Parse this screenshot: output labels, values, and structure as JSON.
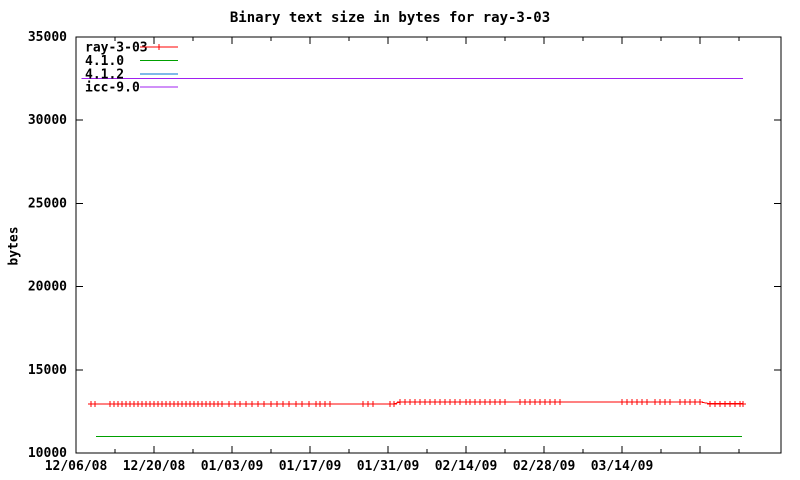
{
  "page": {
    "background_color": "#ffffff",
    "foreground_color": "#000000"
  },
  "chart_data": {
    "type": "line",
    "title": "Binary text size in bytes for ray-3-03",
    "xlabel": "",
    "ylabel": "bytes",
    "ylim": [
      10000,
      35000
    ],
    "ytick_labels": [
      "10000",
      "15000",
      "20000",
      "25000",
      "30000",
      "35000"
    ],
    "ytick_values": [
      10000,
      15000,
      20000,
      25000,
      30000,
      35000
    ],
    "xtick_labels": [
      "12/06/08",
      "12/20/08",
      "01/03/09",
      "01/17/09",
      "01/31/09",
      "02/14/09",
      "02/28/09",
      "03/14/09"
    ],
    "x_major_interval_days": 14,
    "x_minor_interval_days": 7,
    "x_days_total": 126,
    "grid": false,
    "legend_position": "top-left",
    "legend": [
      "ray-3-03",
      "4.1.0",
      "4.1.2",
      "icc-9.0"
    ],
    "series": [
      {
        "name": "ray-3-03",
        "color": "#ff0000",
        "marker": "plus",
        "points": [
          [
            2.7,
            12950
          ],
          [
            3.4,
            12950
          ],
          [
            6.1,
            12950
          ],
          [
            6.8,
            12950
          ],
          [
            7.5,
            12950
          ],
          [
            8.2,
            12950
          ],
          [
            8.9,
            12950
          ],
          [
            9.7,
            12950
          ],
          [
            10.4,
            12950
          ],
          [
            11.1,
            12950
          ],
          [
            11.8,
            12950
          ],
          [
            12.6,
            12950
          ],
          [
            13.3,
            12950
          ],
          [
            14.0,
            12950
          ],
          [
            14.7,
            12950
          ],
          [
            15.4,
            12950
          ],
          [
            16.2,
            12950
          ],
          [
            16.9,
            12950
          ],
          [
            17.6,
            12950
          ],
          [
            18.3,
            12950
          ],
          [
            19.0,
            12950
          ],
          [
            19.8,
            12950
          ],
          [
            20.5,
            12950
          ],
          [
            21.2,
            12950
          ],
          [
            21.9,
            12950
          ],
          [
            22.6,
            12950
          ],
          [
            23.4,
            12950
          ],
          [
            24.1,
            12950
          ],
          [
            24.8,
            12950
          ],
          [
            25.5,
            12950
          ],
          [
            26.2,
            12950
          ],
          [
            27.5,
            12950
          ],
          [
            28.5,
            12950
          ],
          [
            29.5,
            12950
          ],
          [
            30.6,
            12950
          ],
          [
            31.6,
            12950
          ],
          [
            32.7,
            12950
          ],
          [
            33.8,
            12950
          ],
          [
            35.0,
            12950
          ],
          [
            36.1,
            12950
          ],
          [
            37.2,
            12950
          ],
          [
            38.3,
            12950
          ],
          [
            39.4,
            12950
          ],
          [
            40.5,
            12950
          ],
          [
            41.9,
            12950
          ],
          [
            43.1,
            12950
          ],
          [
            43.8,
            12950
          ],
          [
            44.7,
            12950
          ],
          [
            45.6,
            12950
          ],
          [
            51.5,
            12950
          ],
          [
            52.4,
            12950
          ],
          [
            53.3,
            12950
          ],
          [
            56.4,
            12950
          ],
          [
            57.1,
            12950
          ],
          [
            58.2,
            13070
          ],
          [
            59.1,
            13070
          ],
          [
            60.0,
            13070
          ],
          [
            60.9,
            13070
          ],
          [
            61.8,
            13070
          ],
          [
            62.7,
            13070
          ],
          [
            63.6,
            13070
          ],
          [
            64.5,
            13070
          ],
          [
            65.4,
            13070
          ],
          [
            66.3,
            13070
          ],
          [
            67.2,
            13070
          ],
          [
            68.1,
            13070
          ],
          [
            69.0,
            13070
          ],
          [
            70.0,
            13070
          ],
          [
            70.7,
            13070
          ],
          [
            71.6,
            13070
          ],
          [
            72.5,
            13070
          ],
          [
            73.4,
            13070
          ],
          [
            74.3,
            13070
          ],
          [
            75.2,
            13070
          ],
          [
            76.1,
            13070
          ],
          [
            77.0,
            13070
          ],
          [
            79.7,
            13070
          ],
          [
            80.6,
            13070
          ],
          [
            81.5,
            13070
          ],
          [
            82.4,
            13070
          ],
          [
            83.3,
            13070
          ],
          [
            84.2,
            13070
          ],
          [
            85.1,
            13070
          ],
          [
            86.0,
            13070
          ],
          [
            86.9,
            13070
          ],
          [
            98.0,
            13070
          ],
          [
            98.9,
            13070
          ],
          [
            99.8,
            13070
          ],
          [
            100.7,
            13070
          ],
          [
            101.6,
            13070
          ],
          [
            102.5,
            13070
          ],
          [
            103.9,
            13070
          ],
          [
            104.8,
            13070
          ],
          [
            105.7,
            13070
          ],
          [
            106.6,
            13070
          ],
          [
            108.4,
            13070
          ],
          [
            109.3,
            13070
          ],
          [
            110.2,
            13070
          ],
          [
            111.1,
            13070
          ],
          [
            112.0,
            13070
          ],
          [
            113.8,
            12960
          ],
          [
            114.7,
            12960
          ],
          [
            115.6,
            12960
          ],
          [
            116.5,
            12960
          ],
          [
            117.4,
            12960
          ],
          [
            118.3,
            12960
          ],
          [
            119.2,
            12960
          ],
          [
            119.7,
            12960
          ]
        ]
      },
      {
        "name": "4.1.0",
        "color": "#00a000",
        "marker": "none",
        "points": [
          [
            3.6,
            11000
          ],
          [
            119.5,
            11000
          ]
        ]
      },
      {
        "name": "4.1.2",
        "color": "#0070d0",
        "marker": "none",
        "points": [
          [
            1.0,
            32500
          ],
          [
            119.7,
            32500
          ]
        ]
      },
      {
        "name": "icc-9.0",
        "color": "#a020f0",
        "marker": "none",
        "points": [
          [
            1.0,
            32500
          ],
          [
            119.7,
            32500
          ]
        ]
      }
    ]
  }
}
